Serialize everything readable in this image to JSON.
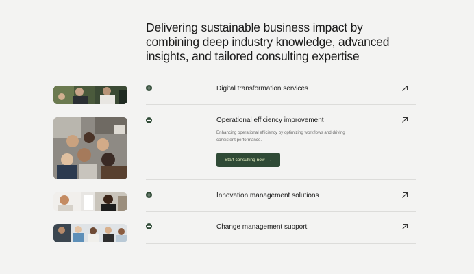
{
  "heading": "Delivering sustainable business impact by combining deep industry knowledge, advanced insights, and tailored consulting expertise",
  "services": [
    {
      "title": "Digital transformation services",
      "icon": "plus-icon",
      "expanded": false
    },
    {
      "title": "Operational efficiency improvement",
      "icon": "minus-icon",
      "expanded": true,
      "description": "Enhancing operational efficiency by optimizing workflows and driving consistent performance.",
      "cta_label": "Start consulting now",
      "cta_arrow": "→"
    },
    {
      "title": "Innovation management solutions",
      "icon": "plus-icon",
      "expanded": false
    },
    {
      "title": "Change management support",
      "icon": "plus-icon",
      "expanded": false
    }
  ],
  "colors": {
    "background": "#f3f3f2",
    "accent": "#2f4a36",
    "cta_text": "#e9f3c4",
    "divider": "#dcdcda"
  }
}
